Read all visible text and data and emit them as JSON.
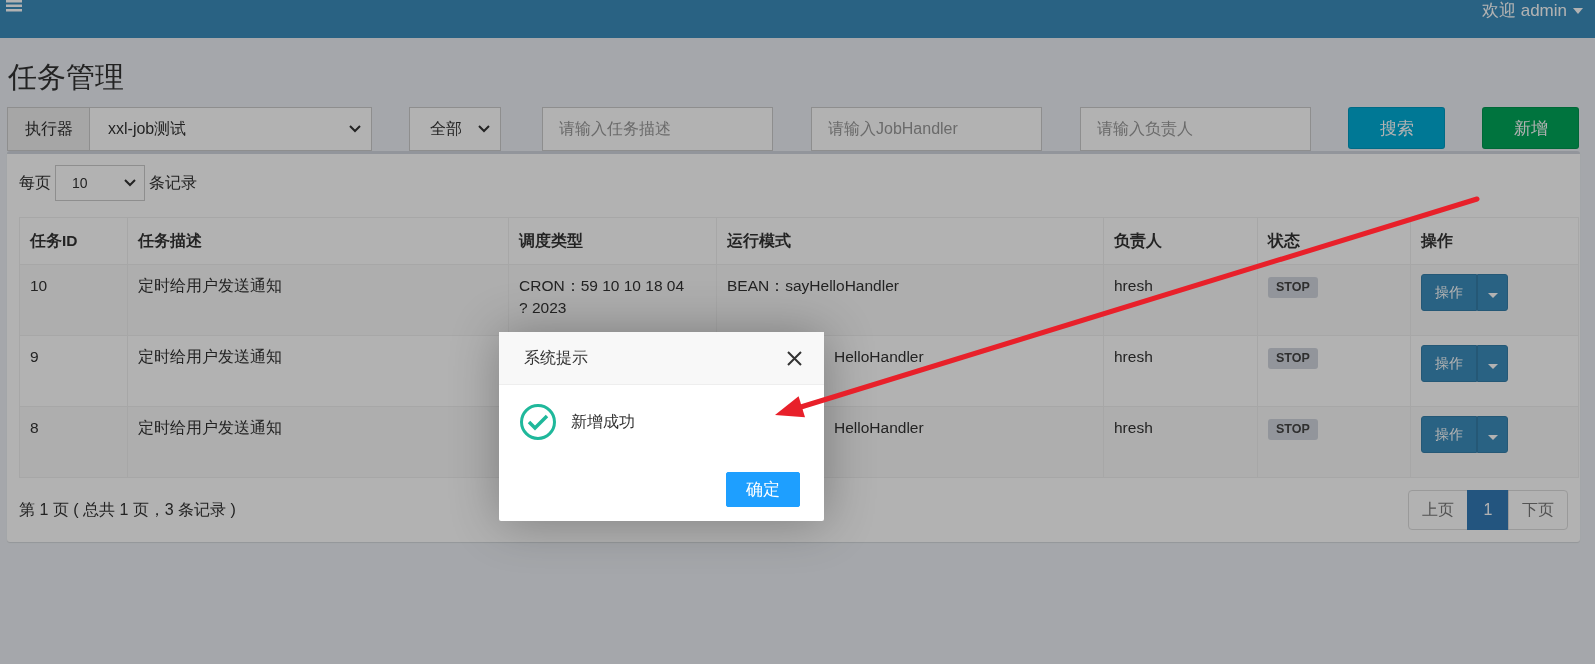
{
  "topbar": {
    "user": "欢迎 admin"
  },
  "page_title": "任务管理",
  "filters": {
    "executor_label": "执行器",
    "executor": "xxl-job测试",
    "status": "全部",
    "placeholders": [
      "请输入任务描述",
      "请输入JobHandler",
      "请输入负责人"
    ],
    "buttons": [
      {
        "label": "搜索",
        "kind": "search"
      },
      {
        "label": "新增",
        "kind": "add"
      }
    ]
  },
  "page_size": {
    "prefix": "每页",
    "value": "10",
    "suffix": "条记录"
  },
  "table": {
    "columns": [
      "任务ID",
      "任务描述",
      "调度类型",
      "运行模式",
      "负责人",
      "状态",
      "操作"
    ],
    "rows": [
      {
        "id": "10",
        "description": "定时给用户发送通知",
        "schedule": "CRON：59 10 10 18 04 ? 2023",
        "mode": "BEAN：sayHelloHandler",
        "covered": false,
        "owner": "hresh",
        "status": "STOP",
        "action": "操作"
      },
      {
        "id": "9",
        "description": "定时给用户发送通知",
        "mode": "HelloHandler",
        "covered": true,
        "owner": "hresh",
        "status": "STOP",
        "action": "操作"
      },
      {
        "id": "8",
        "description": "定时给用户发送通知",
        "mode": "HelloHandler",
        "covered": true,
        "owner": "hresh",
        "status": "STOP",
        "action": "操作"
      }
    ]
  },
  "footer": "第 1 页 ( 总共 1 页，3 条记录 )",
  "pagination": [
    {
      "label": "上页",
      "selected": false
    },
    {
      "label": "1",
      "selected": true
    },
    {
      "label": "下页",
      "selected": false
    }
  ],
  "dialog": {
    "title": "系统提示",
    "message": "新增成功",
    "ok": "确定"
  }
}
